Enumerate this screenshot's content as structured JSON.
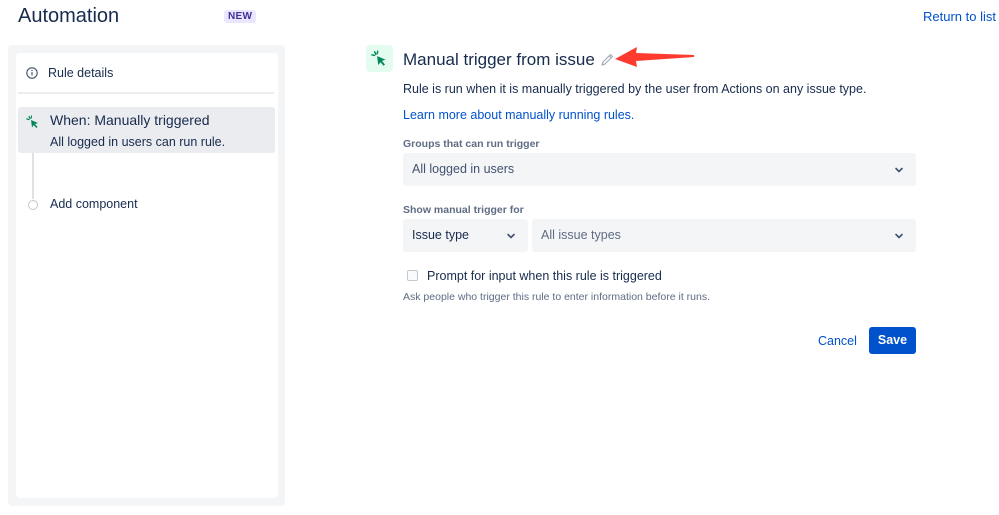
{
  "header": {
    "title": "Automation",
    "badge": "NEW",
    "return_link": "Return to list"
  },
  "sidebar": {
    "rule_details_label": "Rule details",
    "trigger_title": "When: Manually triggered",
    "trigger_subtitle": "All logged in users can run rule.",
    "add_component_label": "Add component"
  },
  "main": {
    "title": "Manual trigger from issue",
    "description": "Rule is run when it is manually triggered by the user from Actions on any issue type.",
    "learn_more": "Learn more about manually running rules.",
    "groups_label": "Groups that can run trigger",
    "groups_value": "All logged in users",
    "show_for_label": "Show manual trigger for",
    "show_for_type": "Issue type",
    "show_for_value": "All issue types",
    "prompt_label": "Prompt for input when this rule is triggered",
    "prompt_checked": false,
    "prompt_help": "Ask people who trigger this rule to enter information before it runs.",
    "cancel_label": "Cancel",
    "save_label": "Save"
  },
  "icons": {
    "info": "info-icon",
    "trigger": "cursor-click-icon",
    "edit": "pencil-icon",
    "chevron": "chevron-down-icon",
    "annotation": "red-arrow-annotation"
  },
  "colors": {
    "link": "#0052cc",
    "primary_button": "#0052cc",
    "trigger_green": "#00875a",
    "annotation_red": "#ff3b30",
    "badge_bg": "#eae6ff",
    "badge_text": "#403294"
  }
}
